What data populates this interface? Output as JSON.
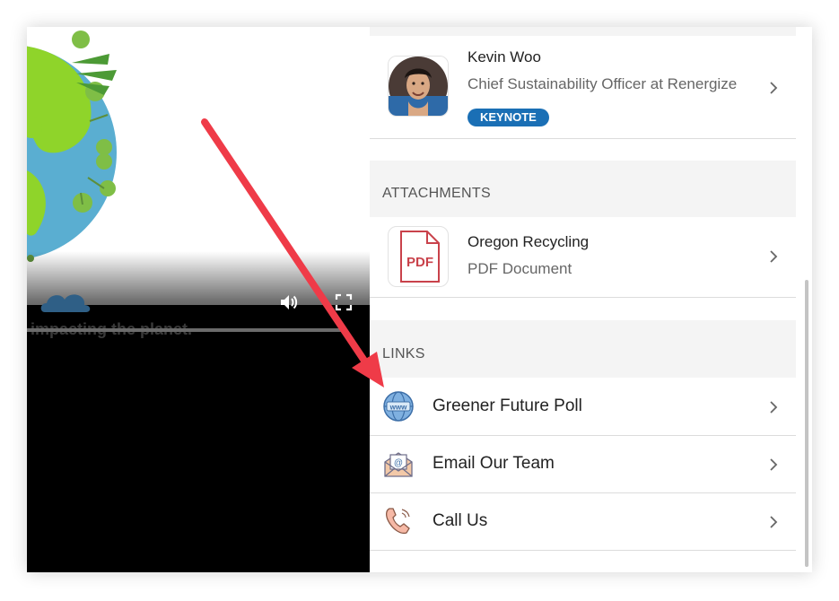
{
  "video": {
    "caption": "impacting the planet."
  },
  "speaker": {
    "name": "Kevin Woo",
    "role": "Chief Sustainability Officer at Renergize",
    "badge": "KEYNOTE"
  },
  "attachments": {
    "heading": "ATTACHMENTS",
    "items": [
      {
        "icon_text": "PDF",
        "title": "Oregon Recycling",
        "subtitle": "PDF Document"
      }
    ]
  },
  "links": {
    "heading": "LINKS",
    "items": [
      {
        "icon": "globe-www-icon",
        "label": "Greener Future Poll"
      },
      {
        "icon": "email-envelope-icon",
        "label": "Email Our Team"
      },
      {
        "icon": "phone-icon",
        "label": "Call Us"
      }
    ]
  },
  "colors": {
    "badge": "#1a6fb5",
    "annotation_arrow": "#ef3b48",
    "pdf_red": "#c9424b"
  },
  "icons": [
    "volume-icon",
    "fullscreen-icon",
    "chevron-right-icon",
    "globe-www-icon",
    "email-envelope-icon",
    "phone-icon",
    "pdf-icon"
  ]
}
